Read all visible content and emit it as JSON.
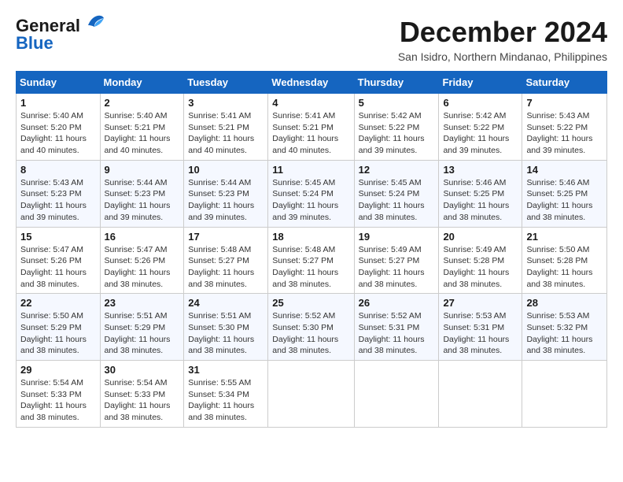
{
  "header": {
    "logo_line1": "General",
    "logo_line2": "Blue",
    "month_title": "December 2024",
    "location": "San Isidro, Northern Mindanao, Philippines"
  },
  "weekdays": [
    "Sunday",
    "Monday",
    "Tuesday",
    "Wednesday",
    "Thursday",
    "Friday",
    "Saturday"
  ],
  "weeks": [
    [
      {
        "day": "1",
        "info": "Sunrise: 5:40 AM\nSunset: 5:20 PM\nDaylight: 11 hours\nand 40 minutes."
      },
      {
        "day": "2",
        "info": "Sunrise: 5:40 AM\nSunset: 5:21 PM\nDaylight: 11 hours\nand 40 minutes."
      },
      {
        "day": "3",
        "info": "Sunrise: 5:41 AM\nSunset: 5:21 PM\nDaylight: 11 hours\nand 40 minutes."
      },
      {
        "day": "4",
        "info": "Sunrise: 5:41 AM\nSunset: 5:21 PM\nDaylight: 11 hours\nand 40 minutes."
      },
      {
        "day": "5",
        "info": "Sunrise: 5:42 AM\nSunset: 5:22 PM\nDaylight: 11 hours\nand 39 minutes."
      },
      {
        "day": "6",
        "info": "Sunrise: 5:42 AM\nSunset: 5:22 PM\nDaylight: 11 hours\nand 39 minutes."
      },
      {
        "day": "7",
        "info": "Sunrise: 5:43 AM\nSunset: 5:22 PM\nDaylight: 11 hours\nand 39 minutes."
      }
    ],
    [
      {
        "day": "8",
        "info": "Sunrise: 5:43 AM\nSunset: 5:23 PM\nDaylight: 11 hours\nand 39 minutes."
      },
      {
        "day": "9",
        "info": "Sunrise: 5:44 AM\nSunset: 5:23 PM\nDaylight: 11 hours\nand 39 minutes."
      },
      {
        "day": "10",
        "info": "Sunrise: 5:44 AM\nSunset: 5:23 PM\nDaylight: 11 hours\nand 39 minutes."
      },
      {
        "day": "11",
        "info": "Sunrise: 5:45 AM\nSunset: 5:24 PM\nDaylight: 11 hours\nand 39 minutes."
      },
      {
        "day": "12",
        "info": "Sunrise: 5:45 AM\nSunset: 5:24 PM\nDaylight: 11 hours\nand 38 minutes."
      },
      {
        "day": "13",
        "info": "Sunrise: 5:46 AM\nSunset: 5:25 PM\nDaylight: 11 hours\nand 38 minutes."
      },
      {
        "day": "14",
        "info": "Sunrise: 5:46 AM\nSunset: 5:25 PM\nDaylight: 11 hours\nand 38 minutes."
      }
    ],
    [
      {
        "day": "15",
        "info": "Sunrise: 5:47 AM\nSunset: 5:26 PM\nDaylight: 11 hours\nand 38 minutes."
      },
      {
        "day": "16",
        "info": "Sunrise: 5:47 AM\nSunset: 5:26 PM\nDaylight: 11 hours\nand 38 minutes."
      },
      {
        "day": "17",
        "info": "Sunrise: 5:48 AM\nSunset: 5:27 PM\nDaylight: 11 hours\nand 38 minutes."
      },
      {
        "day": "18",
        "info": "Sunrise: 5:48 AM\nSunset: 5:27 PM\nDaylight: 11 hours\nand 38 minutes."
      },
      {
        "day": "19",
        "info": "Sunrise: 5:49 AM\nSunset: 5:27 PM\nDaylight: 11 hours\nand 38 minutes."
      },
      {
        "day": "20",
        "info": "Sunrise: 5:49 AM\nSunset: 5:28 PM\nDaylight: 11 hours\nand 38 minutes."
      },
      {
        "day": "21",
        "info": "Sunrise: 5:50 AM\nSunset: 5:28 PM\nDaylight: 11 hours\nand 38 minutes."
      }
    ],
    [
      {
        "day": "22",
        "info": "Sunrise: 5:50 AM\nSunset: 5:29 PM\nDaylight: 11 hours\nand 38 minutes."
      },
      {
        "day": "23",
        "info": "Sunrise: 5:51 AM\nSunset: 5:29 PM\nDaylight: 11 hours\nand 38 minutes."
      },
      {
        "day": "24",
        "info": "Sunrise: 5:51 AM\nSunset: 5:30 PM\nDaylight: 11 hours\nand 38 minutes."
      },
      {
        "day": "25",
        "info": "Sunrise: 5:52 AM\nSunset: 5:30 PM\nDaylight: 11 hours\nand 38 minutes."
      },
      {
        "day": "26",
        "info": "Sunrise: 5:52 AM\nSunset: 5:31 PM\nDaylight: 11 hours\nand 38 minutes."
      },
      {
        "day": "27",
        "info": "Sunrise: 5:53 AM\nSunset: 5:31 PM\nDaylight: 11 hours\nand 38 minutes."
      },
      {
        "day": "28",
        "info": "Sunrise: 5:53 AM\nSunset: 5:32 PM\nDaylight: 11 hours\nand 38 minutes."
      }
    ],
    [
      {
        "day": "29",
        "info": "Sunrise: 5:54 AM\nSunset: 5:33 PM\nDaylight: 11 hours\nand 38 minutes."
      },
      {
        "day": "30",
        "info": "Sunrise: 5:54 AM\nSunset: 5:33 PM\nDaylight: 11 hours\nand 38 minutes."
      },
      {
        "day": "31",
        "info": "Sunrise: 5:55 AM\nSunset: 5:34 PM\nDaylight: 11 hours\nand 38 minutes."
      },
      null,
      null,
      null,
      null
    ]
  ]
}
